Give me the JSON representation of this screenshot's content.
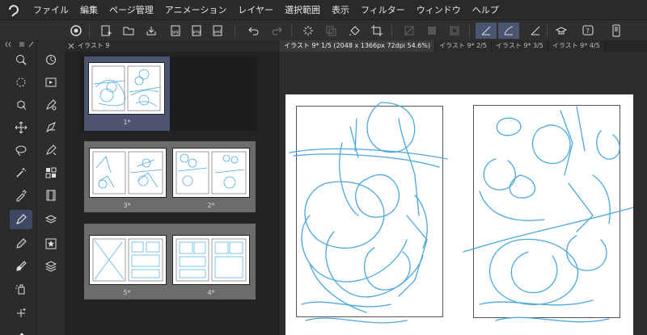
{
  "menu": {
    "items": [
      "ファイル",
      "編集",
      "ページ管理",
      "アニメーション",
      "レイヤー",
      "選択範囲",
      "表示",
      "フィルター",
      "ウィンドウ",
      "ヘルプ"
    ]
  },
  "toolbar": {
    "icons": [
      "clip-studio-icon",
      "new-icon",
      "open-icon",
      "save-icon",
      "export-jpg-icon",
      "export-png-icon",
      "export-psd-icon",
      "undo-icon",
      "redo-icon",
      "loading-icon",
      "transform-icon",
      "fill-icon",
      "crop-icon",
      "clear-icon",
      "border-icon",
      "snap-ruler-icon",
      "snap-special-ruler-icon",
      "snap-grid-icon",
      "companion-icon",
      "help-icon",
      "smartphone-icon"
    ]
  },
  "page_manager": {
    "tab_label": "イラスト 9",
    "pages": [
      {
        "label": "1*"
      },
      {
        "label": "3*"
      },
      {
        "label": "2*"
      },
      {
        "label": "5*"
      },
      {
        "label": "4*"
      }
    ]
  },
  "canvas": {
    "tabs": [
      {
        "label": "イラスト 9* 1/5 (2048 x 1366px 72dpi 54.6%)",
        "active": true
      },
      {
        "label": "イラスト 9* 2/5",
        "active": false
      },
      {
        "label": "イラスト 9* 3/5",
        "active": false
      },
      {
        "label": "イラスト 9* 4/5",
        "active": false
      }
    ]
  },
  "colors": {
    "sketch": "#4aa8e0",
    "accent": "#4a5570"
  }
}
